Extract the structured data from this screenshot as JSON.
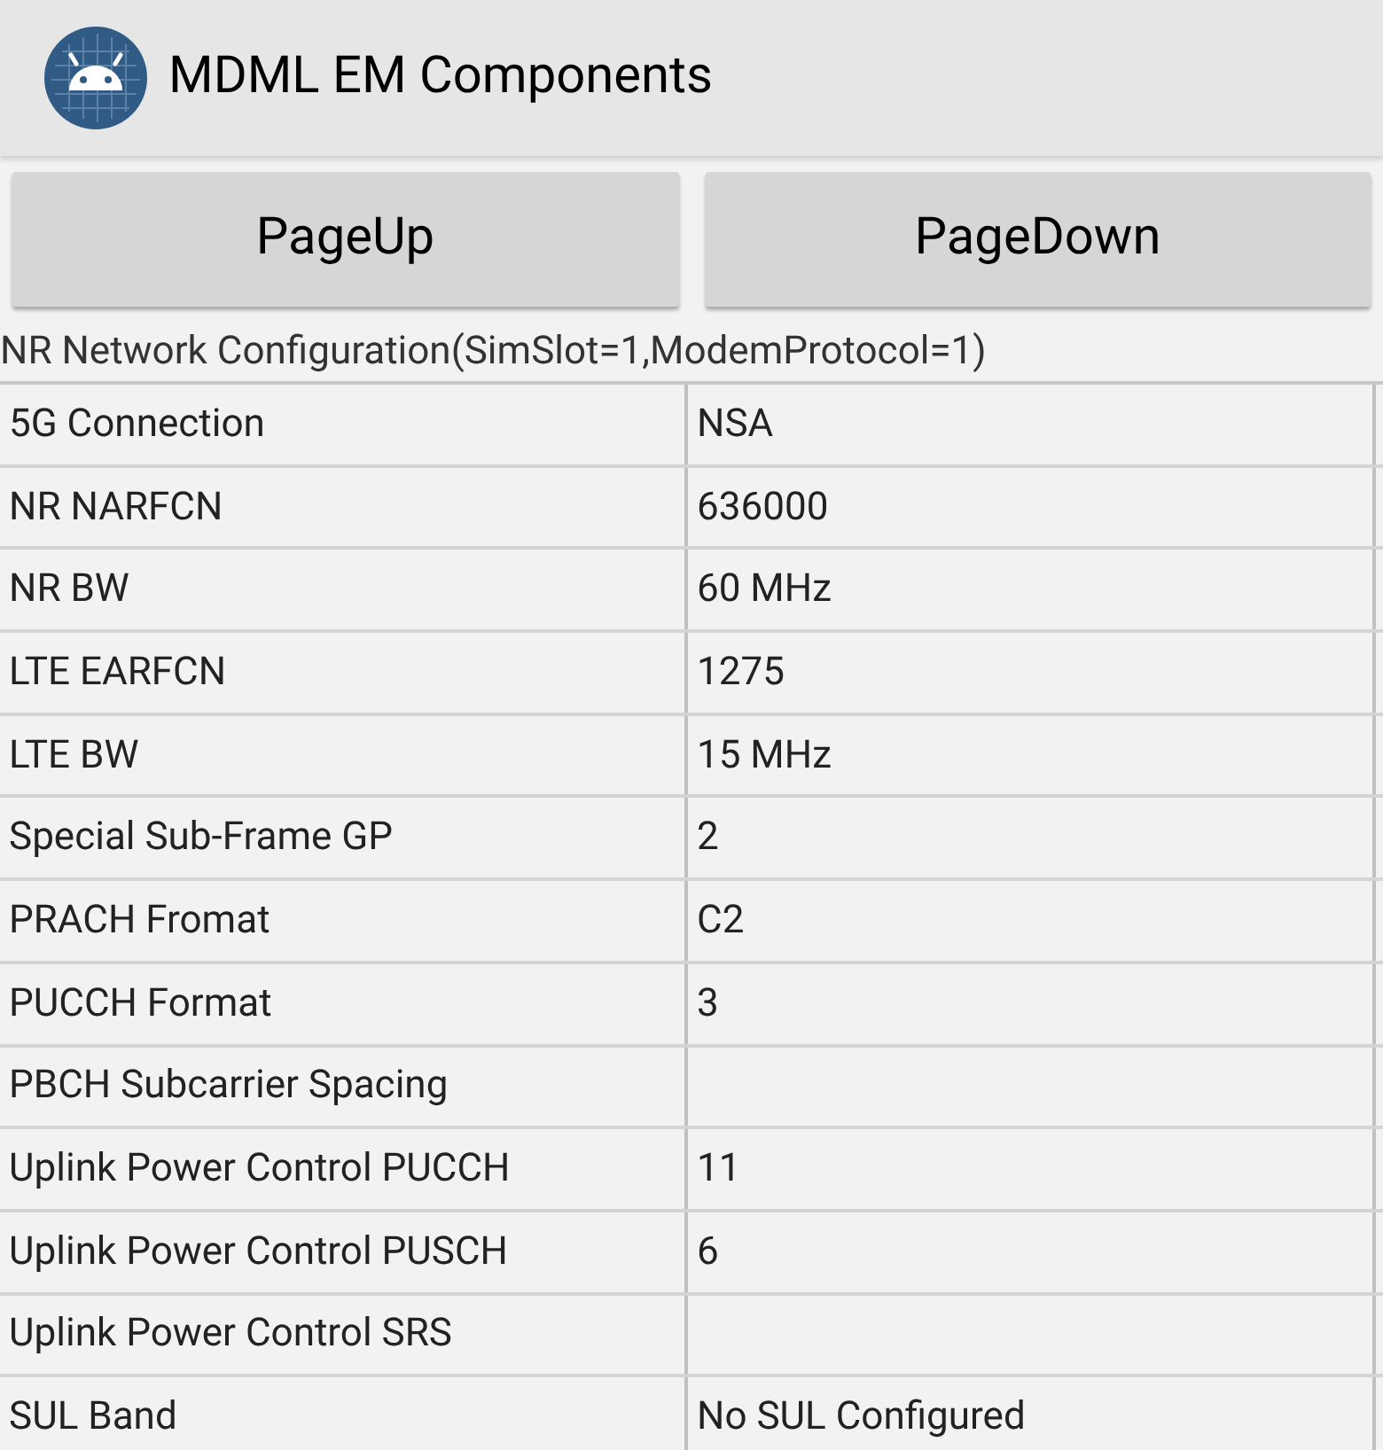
{
  "app_bar": {
    "title": "MDML EM Components"
  },
  "buttons": [
    "PageUp",
    "PageDown"
  ],
  "section_title": "NR Network Configuration(SimSlot=1,ModemProtocol=1)",
  "table": {
    "rows": [
      {
        "label": "5G Connection",
        "value": "NSA"
      },
      {
        "label": "NR NARFCN",
        "value": "636000"
      },
      {
        "label": "NR BW",
        "value": "60 MHz"
      },
      {
        "label": "LTE EARFCN",
        "value": "1275"
      },
      {
        "label": "LTE BW",
        "value": "15 MHz"
      },
      {
        "label": "Special Sub-Frame GP",
        "value": "2"
      },
      {
        "label": "PRACH Fromat",
        "value": "C2"
      },
      {
        "label": "PUCCH Format",
        "value": "3"
      },
      {
        "label": "PBCH Subcarrier Spacing"
      },
      {
        "label": "Uplink Power Control PUCCH",
        "value": "11"
      },
      {
        "label": "Uplink Power Control PUSCH",
        "value": "6"
      },
      {
        "label": "Uplink Power Control SRS"
      },
      {
        "label": "SUL Band",
        "value": "No SUL Configured"
      }
    ]
  }
}
